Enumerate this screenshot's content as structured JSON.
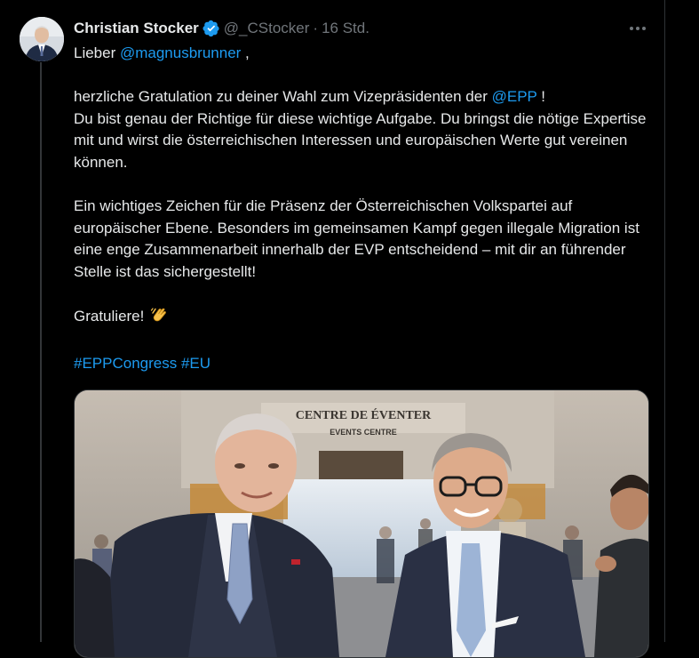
{
  "tweet": {
    "author_name": "Christian Stocker",
    "handle": "@_CStocker",
    "separator": "·",
    "time": "16 Std.",
    "lines": {
      "greeting_prefix": "Lieber ",
      "greeting_mention": "@magnusbrunner",
      "greeting_suffix": " ,",
      "p1_text": "herzliche Gratulation zu deiner Wahl zum Vizepräsidenten der ",
      "p1_mention": "@EPP",
      "p1_suffix": " !",
      "p1_rest": "Du bist genau der Richtige für diese wichtige Aufgabe. Du bringst die nötige Expertise mit und wirst die österreichischen Interessen und europäischen Werte gut vereinen können.",
      "p2": "Ein wichtiges Zeichen für die Präsenz der Österreichischen Volkspartei auf europäischer Ebene. Besonders im gemeinsamen Kampf gegen illegale Migration ist eine enge Zusammenarbeit innerhalb der EVP entscheidend – mit dir an führender Stelle ist das sichergestellt!",
      "p3": "Gratuliere!",
      "hashtag1": "#EPPCongress",
      "hashtag2": "#EU"
    },
    "media": {
      "sign_line1": "CENTRE DE ÉVENTER",
      "sign_line2": "EVENTS CENTRE"
    }
  },
  "colors": {
    "background": "#000000",
    "text": "#e7e9ea",
    "secondary_text": "#71767b",
    "link": "#1d9bf0",
    "verified": "#1d9bf0"
  },
  "icons": [
    "verified-badge-icon",
    "more-options-icon",
    "clapping-hands-emoji"
  ]
}
